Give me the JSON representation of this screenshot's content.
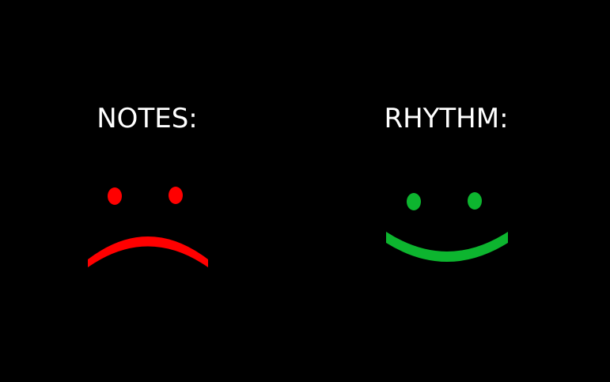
{
  "panels": [
    {
      "label": "NOTES:",
      "face": "sad-face-icon",
      "color": "#ff0000"
    },
    {
      "label": "RHYTHM:",
      "face": "happy-face-icon",
      "color": "#0db52f"
    }
  ],
  "background": "#000000",
  "text_color": "#ffffff"
}
